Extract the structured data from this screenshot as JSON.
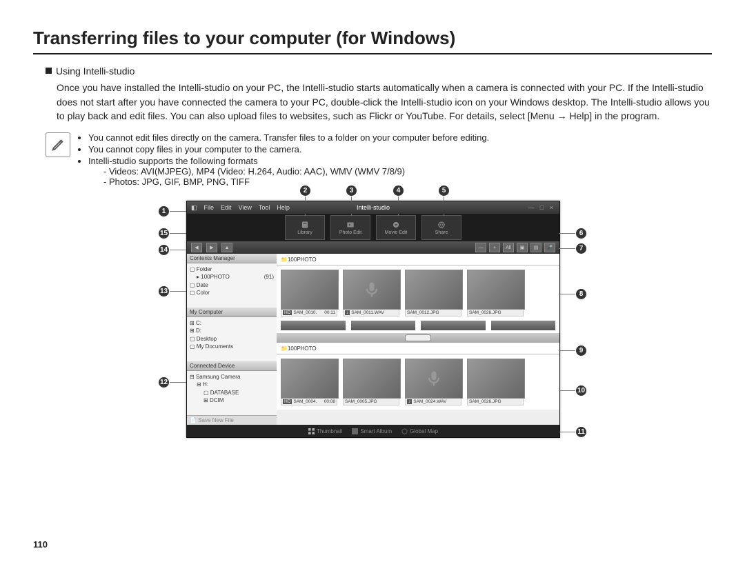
{
  "page_title": "Transferring files to your computer (for Windows)",
  "section_label": "Using Intelli-studio",
  "description": "Once you have installed the Intelli-studio on your PC, the Intelli-studio starts automatically when a camera is connected with your PC. If the Intelli-studio does not start after you have connected the camera to your PC, double-click the Intelli-studio icon on your Windows desktop. The Intelli-studio allows you to play back and edit files. You can also upload files to websites, such as Flickr or YouTube. For details, select [Menu → Help] in the program.",
  "notes": {
    "n1": "You cannot edit files directly on the camera. Transfer files to a folder on your computer before editing.",
    "n2": "You cannot copy files in your computer to the camera.",
    "n3": "Intelli-studio supports the following formats",
    "n3a": "- Videos: AVI(MJPEG), MP4 (Video: H.264, Audio: AAC), WMV (WMV 7/8/9)",
    "n3b": "- Photos: JPG, GIF, BMP, PNG, TIFF"
  },
  "callouts": {
    "c1": "1",
    "c2": "2",
    "c3": "3",
    "c4": "4",
    "c5": "5",
    "c6": "6",
    "c7": "7",
    "c8": "8",
    "c9": "9",
    "c10": "10",
    "c11": "11",
    "c12": "12",
    "c13": "13",
    "c14": "14",
    "c15": "15"
  },
  "app": {
    "brand": "Intelli-studio",
    "menu": {
      "file": "File",
      "edit": "Edit",
      "view": "View",
      "tool": "Tool",
      "help": "Help"
    },
    "win_controls": "— □ ×",
    "modes": {
      "library": "Library",
      "photoedit": "Photo Edit",
      "movieedit": "Movie Edit",
      "share": "Share"
    },
    "filter_all": "All",
    "side": {
      "contents": "Contents Manager",
      "folder": "Folder",
      "f100": "100PHOTO",
      "f100_count": "(91)",
      "date": "Date",
      "color": "Color",
      "mycomp": "My Computer",
      "c": "C:",
      "d": "D:",
      "desk": "Desktop",
      "docs": "My Documents",
      "connected": "Connected Device",
      "cam": "Samsung Camera",
      "h": "H:",
      "db": "DATABASE",
      "dcim": "DCIM",
      "save": "Save New File"
    },
    "crumb_top": "100PHOTO",
    "crumb_bot": "100PHOTO",
    "thumbs_top": [
      {
        "badge": "HD",
        "name": "SAM_0010.",
        "extra": "00:11"
      },
      {
        "badge": "♪",
        "name": "SAM_0011.WAV",
        "extra": ""
      },
      {
        "badge": "",
        "name": "SAM_0012.JPG",
        "extra": ""
      },
      {
        "badge": "",
        "name": "SAM_0026.JPG",
        "extra": ""
      }
    ],
    "thumbs_bot": [
      {
        "badge": "HD",
        "name": "SAM_0004.",
        "extra": "00:08"
      },
      {
        "badge": "",
        "name": "SAM_0005.JPG",
        "extra": ""
      },
      {
        "badge": "♪",
        "name": "SAM_0024.WAV",
        "extra": ""
      },
      {
        "badge": "",
        "name": "SAM_0026.JPG",
        "extra": ""
      }
    ],
    "footer": {
      "thumb": "Thumbnail",
      "smart": "Smart Album",
      "map": "Global Map"
    }
  },
  "page_number": "110"
}
